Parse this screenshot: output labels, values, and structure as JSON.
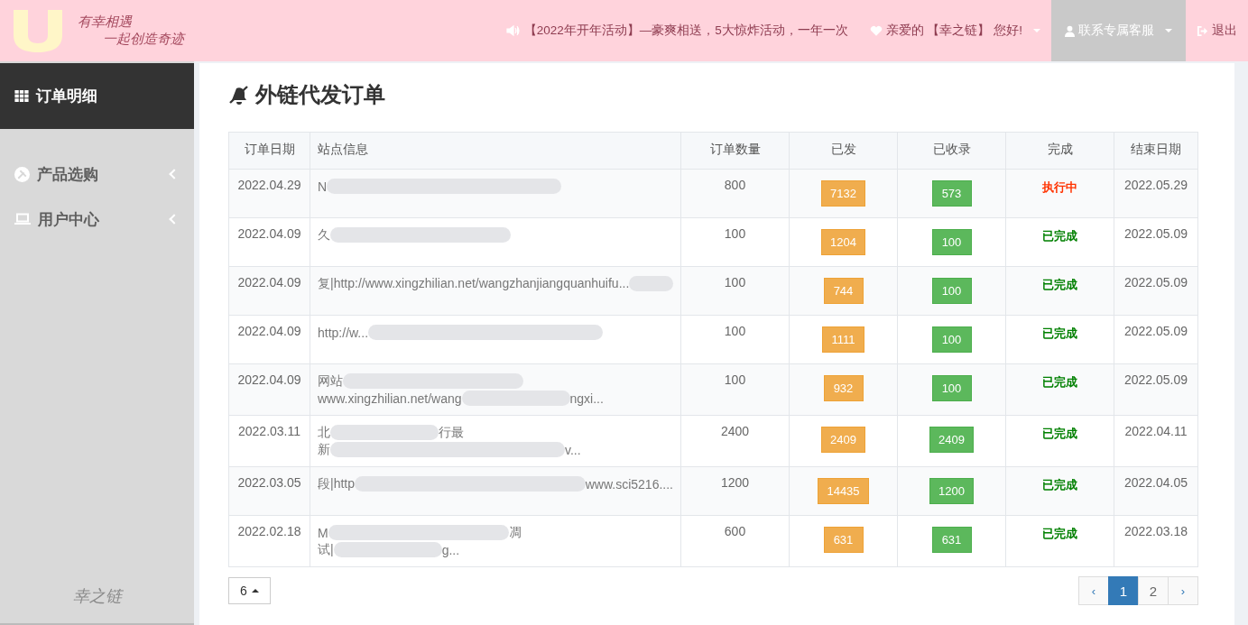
{
  "header": {
    "slogan_lines": [
      "有幸相遇",
      "一起创造奇迹"
    ],
    "notice": "【2022年开年活动】—豪爽相送，5大惊炸活动，一年一次",
    "greeting": "亲爱的 【幸之链】 您好!",
    "service": "联系专属客服",
    "logout": "退出"
  },
  "sidebar": {
    "items": [
      {
        "label": "订单明细",
        "selected": true,
        "has_arrow": false
      },
      {
        "label": "产品选购",
        "selected": false,
        "has_arrow": true
      },
      {
        "label": "用户中心",
        "selected": false,
        "has_arrow": true
      }
    ],
    "footer_logo": "幸之链"
  },
  "page_title": "外链代发订单",
  "table": {
    "columns": [
      "订单日期",
      "站点信息",
      "订单数量",
      "已发",
      "已收录",
      "完成",
      "结束日期"
    ],
    "rows": [
      {
        "date": "2022.04.29",
        "site_lines": [
          [
            "N"
          ]
        ],
        "quantity": "800",
        "sent": "7132",
        "indexed": "573",
        "status": "执行中",
        "in_progress": true,
        "end_date": "2022.05.29"
      },
      {
        "date": "2022.04.09",
        "site_lines": [
          [
            "久"
          ]
        ],
        "quantity": "100",
        "sent": "1204",
        "indexed": "100",
        "status": "已完成",
        "in_progress": false,
        "end_date": "2022.05.09"
      },
      {
        "date": "2022.04.09",
        "site_lines": [
          [
            "复|http://www.xingzhilian.net/wangzhanjiangquanhuifu..."
          ]
        ],
        "quantity": "100",
        "sent": "744",
        "indexed": "100",
        "status": "已完成",
        "in_progress": false,
        "end_date": "2022.05.09"
      },
      {
        "date": "2022.04.09",
        "site_lines": [
          [
            "http://w..."
          ]
        ],
        "quantity": "100",
        "sent": "1111",
        "indexed": "100",
        "status": "已完成",
        "in_progress": false,
        "end_date": "2022.05.09"
      },
      {
        "date": "2022.04.09",
        "site_lines": [
          [
            "网站"
          ],
          [
            "www.xingzhilian.net/wang",
            "ngxi..."
          ]
        ],
        "quantity": "100",
        "sent": "932",
        "indexed": "100",
        "status": "已完成",
        "in_progress": false,
        "end_date": "2022.05.09"
      },
      {
        "date": "2022.03.11",
        "site_lines": [
          [
            "北",
            "行最"
          ],
          [
            "新",
            "v..."
          ]
        ],
        "quantity": "2400",
        "sent": "2409",
        "indexed": "2409",
        "status": "已完成",
        "in_progress": false,
        "end_date": "2022.04.11"
      },
      {
        "date": "2022.03.05",
        "site_lines": [
          [
            "段|http",
            "www.sci5216...."
          ]
        ],
        "quantity": "1200",
        "sent": "14435",
        "indexed": "1200",
        "status": "已完成",
        "in_progress": false,
        "end_date": "2022.04.05"
      },
      {
        "date": "2022.02.18",
        "site_lines": [
          [
            "M",
            "凋"
          ],
          [
            "试|",
            "g..."
          ]
        ],
        "quantity": "600",
        "sent": "631",
        "indexed": "631",
        "status": "已完成",
        "in_progress": false,
        "end_date": "2022.03.18"
      }
    ]
  },
  "page_size": "6",
  "pagination": {
    "prev": "‹",
    "next": "›",
    "pages": [
      {
        "label": "1",
        "selected": true
      },
      {
        "label": "2",
        "selected": false
      }
    ]
  }
}
